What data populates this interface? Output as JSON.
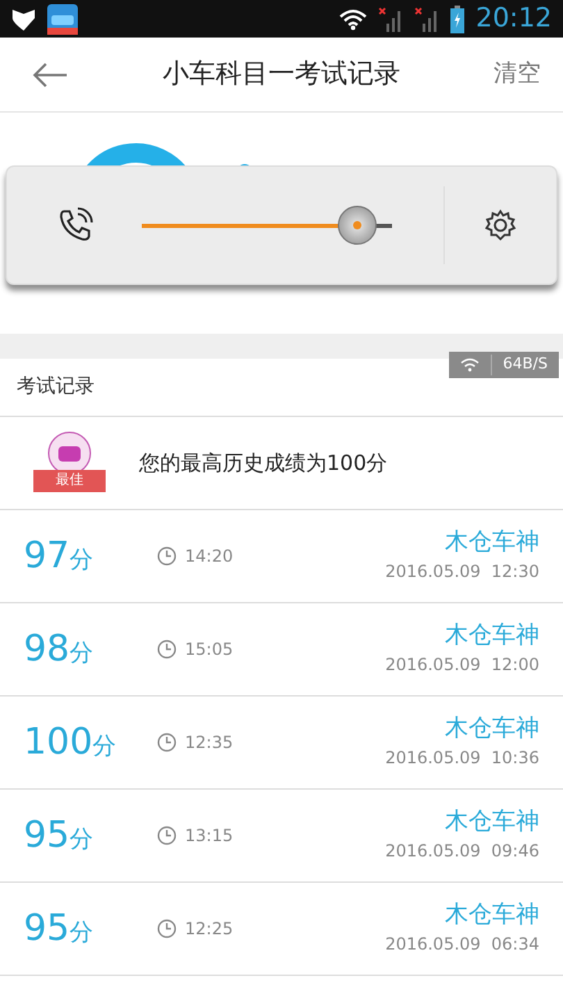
{
  "status_bar": {
    "time": "20:12"
  },
  "header": {
    "title": "小车科目一考试记录",
    "action": "清空"
  },
  "volume_popup": {
    "level": 0.86
  },
  "network_badge": {
    "speed": "64B/S"
  },
  "section_title": "考试记录",
  "best": {
    "badge": "最佳",
    "text": "您的最高历史成绩为100分"
  },
  "records": [
    {
      "score": "97",
      "unit": "分",
      "duration": "14:20",
      "name": "木仓车神",
      "date": "2016.05.09  12:30"
    },
    {
      "score": "98",
      "unit": "分",
      "duration": "15:05",
      "name": "木仓车神",
      "date": "2016.05.09  12:00"
    },
    {
      "score": "100",
      "unit": "分",
      "duration": "12:35",
      "name": "木仓车神",
      "date": "2016.05.09  10:36"
    },
    {
      "score": "95",
      "unit": "分",
      "duration": "13:15",
      "name": "木仓车神",
      "date": "2016.05.09  09:46"
    },
    {
      "score": "95",
      "unit": "分",
      "duration": "12:25",
      "name": "木仓车神",
      "date": "2016.05.09  06:34"
    }
  ]
}
